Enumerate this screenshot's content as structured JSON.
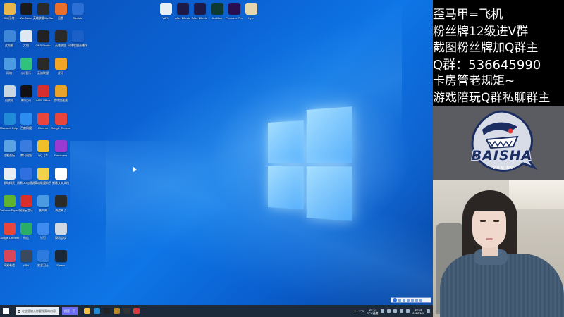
{
  "desktop": {
    "icons": [
      {
        "label": "360压缩",
        "icon": "folder-icon",
        "color": "#e8b64a"
      },
      {
        "label": "WeGame",
        "icon": "wegame-icon",
        "color": "#1a1a1a"
      },
      {
        "label": "英雄联盟WeGame版",
        "icon": "lol-icon",
        "color": "#2a2a2a"
      },
      {
        "label": "迅雷",
        "icon": "app-icon",
        "color": "#ea6f2a"
      },
      {
        "label": "Sketch",
        "icon": "pen-icon",
        "color": "#2c6fd6"
      },
      {
        "label": "此电脑",
        "icon": "computer-icon",
        "color": "#3e86d8"
      },
      {
        "label": "文档",
        "icon": "file-icon",
        "color": "#dfe8f0"
      },
      {
        "label": "OBS Studio",
        "icon": "obs-icon",
        "color": "#222222"
      },
      {
        "label": "英雄联盟",
        "icon": "lol-icon",
        "color": "#2a2a2a"
      },
      {
        "label": "英雄联盟直播伴侣",
        "icon": "app-icon",
        "color": "#1b5fc9"
      },
      {
        "label": "网络",
        "icon": "network-icon",
        "color": "#4a9be2"
      },
      {
        "label": "QQ音乐",
        "icon": "music-icon",
        "color": "#31c27c"
      },
      {
        "label": "英雄联盟",
        "icon": "lol-icon",
        "color": "#2a2a2a"
      },
      {
        "label": "虎牙",
        "icon": "app-icon",
        "color": "#f2a526"
      },
      {
        "label": "回收站",
        "icon": "recycle-bin-icon",
        "color": "#c9d6e2"
      },
      {
        "label": "腾讯QQ",
        "icon": "qq-icon",
        "color": "#111111"
      },
      {
        "label": "WPS Office",
        "icon": "wps-icon",
        "color": "#d72f2f"
      },
      {
        "label": "游戏加速器",
        "icon": "app-icon",
        "color": "#e8a32a"
      },
      {
        "label": "Microsoft Edge",
        "icon": "edge-icon",
        "color": "#1f8ad6"
      },
      {
        "label": "百度网盘",
        "icon": "cloud-icon",
        "color": "#2d8cf0"
      },
      {
        "label": "Chrome",
        "icon": "chrome-icon",
        "color": "#e8453c"
      },
      {
        "label": "Google Chrome",
        "icon": "chrome-icon",
        "color": "#e8453c"
      },
      {
        "label": "控制面板",
        "icon": "control-panel-icon",
        "color": "#5ba2e0"
      },
      {
        "label": "腾讯视频",
        "icon": "video-icon",
        "color": "#3a7be0"
      },
      {
        "label": "QQ飞车",
        "icon": "app-icon",
        "color": "#f0c02a"
      },
      {
        "label": "Bandicam",
        "icon": "app-icon",
        "color": "#9b3ad0"
      },
      {
        "label": "驱动精灵",
        "icon": "app-icon",
        "color": "#e9eef3"
      },
      {
        "label": "网易UU加速器",
        "icon": "app-icon",
        "color": "#2f6fe0"
      },
      {
        "label": "英雄联盟助手",
        "icon": "app-icon",
        "color": "#f3d24b"
      },
      {
        "label": "新建文本文档",
        "icon": "text-file-icon",
        "color": "#ffffff"
      },
      {
        "label": "GeForce Experience",
        "icon": "nvidia-icon",
        "color": "#5fb32e"
      },
      {
        "label": "网易云音乐",
        "icon": "music-icon",
        "color": "#d7302b"
      },
      {
        "label": "鲁大师",
        "icon": "app-icon",
        "color": "#4a9be2"
      },
      {
        "label": "海盗来了",
        "icon": "app-icon",
        "color": "#2a2a2a"
      },
      {
        "label": "Google Chrome",
        "icon": "chrome-icon",
        "color": "#e8453c"
      },
      {
        "label": "微信",
        "icon": "wechat-icon",
        "color": "#2aae67"
      },
      {
        "label": "钉钉",
        "icon": "app-icon",
        "color": "#3f8cf0"
      },
      {
        "label": "腾讯会议",
        "icon": "app-icon",
        "color": "#cfd8e3"
      },
      {
        "label": "网易有道",
        "icon": "app-icon",
        "color": "#d8465a"
      },
      {
        "label": "VPN",
        "icon": "app-icon",
        "color": "#3a4a5c"
      },
      {
        "label": "安全卫士",
        "icon": "shield-icon",
        "color": "#2e7be0"
      },
      {
        "label": "Steam",
        "icon": "steam-icon",
        "color": "#1b2838"
      }
    ],
    "top_icons": [
      {
        "label": "WPS",
        "icon": "file-icon",
        "color": "#e7eef4"
      },
      {
        "label": "After Effects",
        "icon": "ae-icon",
        "color": "#1e1a48"
      },
      {
        "label": "After Effects",
        "icon": "ae-icon",
        "color": "#1e1a48"
      },
      {
        "label": "Audition",
        "icon": "au-icon",
        "color": "#0d3b33"
      },
      {
        "label": "Premiere Pro",
        "icon": "pr-icon",
        "color": "#2a0f4f"
      },
      {
        "label": "Kyle",
        "icon": "file-icon",
        "color": "#e6d6b0"
      }
    ]
  },
  "taskbar": {
    "search_placeholder": "在这里输入你要搜索的内容",
    "ai_button": "搜索一下",
    "apps": [
      {
        "icon": "file-explorer-icon",
        "color": "#f0c14b"
      },
      {
        "icon": "edge-icon",
        "color": "#1f8ad6"
      },
      {
        "icon": "app-icon",
        "color": "#222222"
      },
      {
        "icon": "lol-icon",
        "color": "#b8862c"
      },
      {
        "icon": "obs-icon",
        "color": "#333333"
      },
      {
        "icon": "app-icon",
        "color": "#d83b3b"
      }
    ],
    "weather": "1°C",
    "weather_sub": "24°C",
    "cpu": "CPU温度",
    "time": "19:14",
    "date": "2022/1/9"
  },
  "stream_panel": {
    "notes": [
      "歪马甲=飞机",
      "粉丝牌12级进V群",
      "截图粉丝牌加Q群主",
      "Q群：536645990",
      "卡房管老规矩~",
      "游戏陪玩Q群私聊群主"
    ],
    "logo_text": "BAISHA",
    "logo_sub": "GAMING"
  },
  "colors": {
    "desktop_accent": "#0b63d4",
    "taskbar": "#1c2a3a",
    "logo_navy": "#1c2d62"
  }
}
